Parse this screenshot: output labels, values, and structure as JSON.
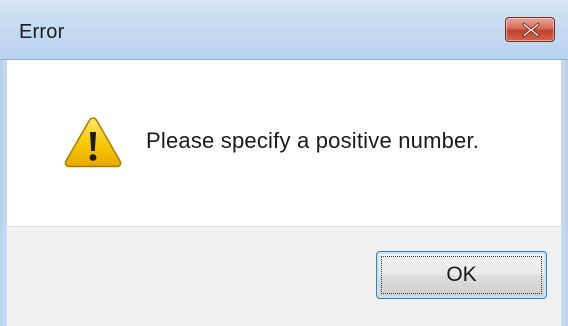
{
  "dialog": {
    "title": "Error",
    "message": "Please specify a positive number.",
    "icon": "warning-icon",
    "close_icon": "close-icon",
    "ok_label": "OK",
    "colors": {
      "titlebar": "#c4dbf1",
      "close_button": "#c0402a",
      "footer": "#f0f0f0",
      "warning_fill": "#f6c400",
      "button_focus": "#3c7fb1"
    }
  }
}
